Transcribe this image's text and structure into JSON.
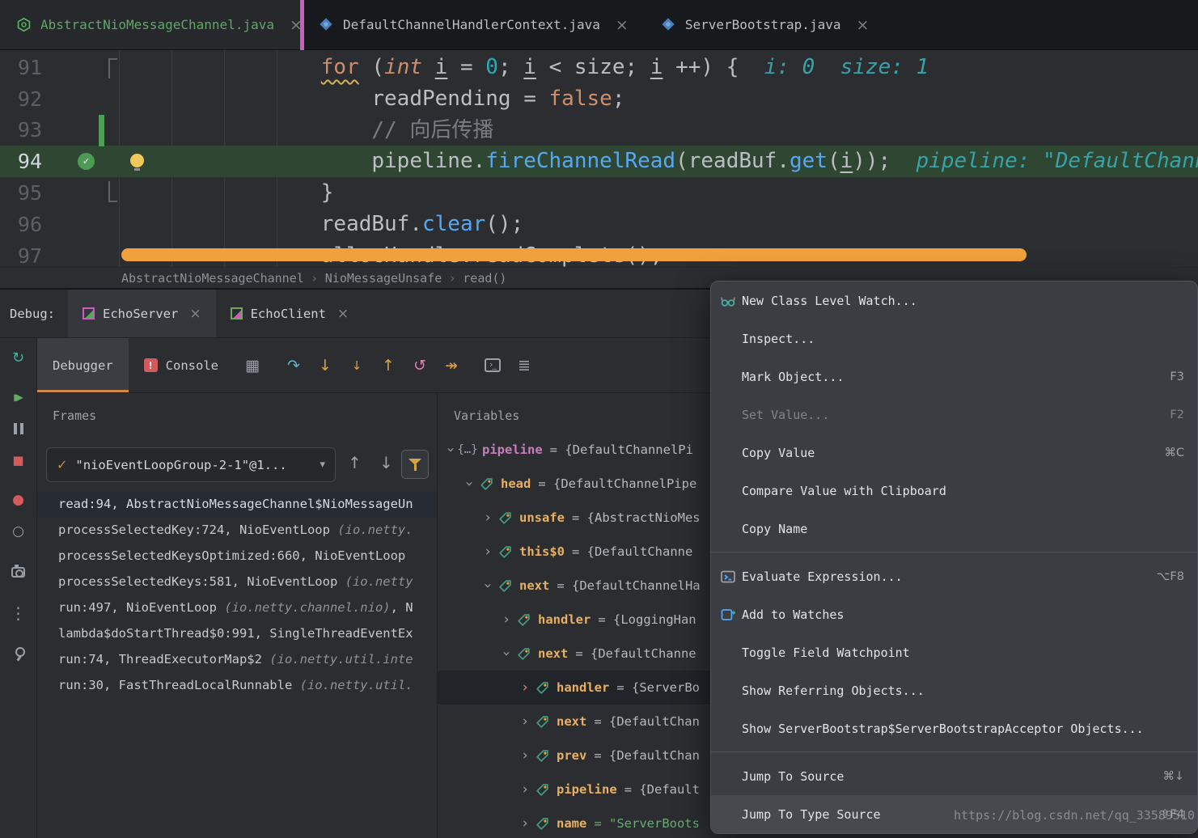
{
  "icons": {
    "check": "✓",
    "combo_arrow": "▾",
    "up_arrow": "↑",
    "down_arrow": "↓",
    "braces": "{…}",
    "close": "×",
    "chevron": "›",
    "breadcrumb_sep": "›"
  },
  "colors": {
    "accent_green": "#5fa865",
    "exec_line": "#2e4632",
    "scrollbar_orange": "#f0a03c",
    "tab_stripe_magenta": "#c75fbc",
    "error_red": "#d35b5b",
    "debugger_tab_underline": "#d08844"
  },
  "editor_tabs": [
    {
      "label": "AbstractNioMessageChannel.java",
      "icon": "class-icon-green",
      "active": true
    },
    {
      "label": "DefaultChannelHandlerContext.java",
      "icon": "class-icon-blue",
      "active": false
    },
    {
      "label": "ServerBootstrap.java",
      "icon": "class-icon-blue",
      "active": false
    }
  ],
  "editor": {
    "lines": [
      {
        "num": "91",
        "indent": 18,
        "tokens": [
          {
            "t": "for",
            "c": "kw wavy"
          },
          {
            "t": " (",
            "c": "pl"
          },
          {
            "t": "int",
            "c": "kw it"
          },
          {
            "t": " ",
            "c": "pl"
          },
          {
            "t": "i",
            "c": "pl u"
          },
          {
            "t": " = ",
            "c": "pl"
          },
          {
            "t": "0",
            "c": "num"
          },
          {
            "t": "; ",
            "c": "pl"
          },
          {
            "t": "i",
            "c": "pl u"
          },
          {
            "t": " < size; ",
            "c": "pl"
          },
          {
            "t": "i",
            "c": "pl u"
          },
          {
            "t": " ++) { ",
            "c": "pl"
          },
          {
            "t": " i: 0  size: 1",
            "c": "hint"
          }
        ]
      },
      {
        "num": "92",
        "indent": 22,
        "tokens": [
          {
            "t": "readPending ",
            "c": "pl"
          },
          {
            "t": "= ",
            "c": "pl"
          },
          {
            "t": "false",
            "c": "kw"
          },
          {
            "t": ";",
            "c": "pl"
          }
        ]
      },
      {
        "num": "93",
        "indent": 22,
        "tokens": [
          {
            "t": "// 向后传播",
            "c": "cmt"
          }
        ]
      },
      {
        "num": "94",
        "indent": 22,
        "exec": true,
        "tokens": [
          {
            "t": "pipeline",
            "c": "pl"
          },
          {
            "t": ".",
            "c": "pl"
          },
          {
            "t": "fireChannelRead",
            "c": "m"
          },
          {
            "t": "(",
            "c": "pl"
          },
          {
            "t": "readBuf",
            "c": "pl"
          },
          {
            "t": ".",
            "c": "pl"
          },
          {
            "t": "get",
            "c": "m"
          },
          {
            "t": "(",
            "c": "pl"
          },
          {
            "t": "i",
            "c": "pl u"
          },
          {
            "t": "));",
            "c": "pl"
          },
          {
            "t": "  pipeline: \"DefaultChannelPipeline\"",
            "c": "hint"
          }
        ]
      },
      {
        "num": "95",
        "indent": 18,
        "tokens": [
          {
            "t": "}",
            "c": "pl"
          }
        ]
      },
      {
        "num": "96",
        "indent": 18,
        "tokens": [
          {
            "t": "readBuf",
            "c": "pl"
          },
          {
            "t": ".",
            "c": "pl"
          },
          {
            "t": "clear",
            "c": "m"
          },
          {
            "t": "();",
            "c": "pl"
          }
        ]
      },
      {
        "num": "97",
        "indent": 18,
        "tokens": [
          {
            "t": "allocHandle.readComplete();",
            "c": "pl"
          }
        ]
      }
    ],
    "breadcrumb": [
      "AbstractNioMessageChannel",
      "NioMessageUnsafe",
      "read()"
    ]
  },
  "debug": {
    "label": "Debug:",
    "session_tabs": [
      {
        "label": "EchoServer",
        "icon": "run-config-server-icon",
        "active": true
      },
      {
        "label": "EchoClient",
        "icon": "run-config-client-icon",
        "active": false
      }
    ],
    "view_tabs": [
      {
        "label": "Debugger",
        "active": true
      },
      {
        "label": "Console",
        "icon": "console-error-icon",
        "badge": "!",
        "active": false
      }
    ],
    "toolbar_icons": [
      {
        "name": "restore-layout-icon",
        "glyph": "▦",
        "cls": "ic-gray"
      },
      {
        "name": "step-over-icon",
        "glyph": "↷",
        "cls": "ic-blue",
        "gap": true
      },
      {
        "name": "step-into-icon",
        "glyph": "↓",
        "cls": "ic-amber"
      },
      {
        "name": "force-step-into-icon",
        "glyph": "↓",
        "cls": "ic-amber sm"
      },
      {
        "name": "step-out-icon",
        "glyph": "↑",
        "cls": "ic-amber"
      },
      {
        "name": "reset-frame-icon",
        "glyph": "↺",
        "cls": "ic-pink"
      },
      {
        "name": "run-to-cursor-icon",
        "glyph": "↠",
        "cls": "ic-amber"
      },
      {
        "name": "open-console-icon",
        "glyph": "›_",
        "cls": "ic-consolebox",
        "gap": true
      },
      {
        "name": "settings-sliders-icon",
        "glyph": "≣",
        "cls": "ic-gray"
      }
    ],
    "rail_icons": [
      {
        "name": "rerun-icon",
        "glyph": "↻",
        "cls": "ic-teal s18"
      },
      {
        "name": "resume-icon",
        "glyph": "▶▶",
        "cls": "resume"
      },
      {
        "name": "pause-icon",
        "glyph": "",
        "cls": "ic-pause"
      },
      {
        "name": "stop-icon",
        "glyph": "■",
        "cls": "ic-red s15"
      },
      {
        "name": "record-icon",
        "glyph": "●",
        "cls": "ic-red s17"
      },
      {
        "name": "breakpoint-circle-icon",
        "glyph": "○",
        "cls": "ic-gray s17"
      },
      {
        "name": "screenshot-icon",
        "glyph": "",
        "cls": "ic-camera"
      },
      {
        "name": "more-icon",
        "glyph": "⋮",
        "cls": "ic-gray s20"
      },
      {
        "name": "pin-icon",
        "glyph": "",
        "cls": "ic-pin"
      }
    ],
    "frames": {
      "title": "Frames",
      "thread": "\"nioEventLoopGroup-2-1\"@1...",
      "rows": [
        {
          "selected": true,
          "parts": [
            {
              "t": "read:94, AbstractNioMessageChannel$NioMessageUn"
            }
          ]
        },
        {
          "parts": [
            {
              "t": "processSelectedKey:724, NioEventLoop "
            },
            {
              "t": "(io.netty.",
              "em": true
            }
          ]
        },
        {
          "parts": [
            {
              "t": "processSelectedKeysOptimized:660, NioEventLoop"
            }
          ]
        },
        {
          "parts": [
            {
              "t": "processSelectedKeys:581, NioEventLoop "
            },
            {
              "t": "(io.netty",
              "em": true
            }
          ]
        },
        {
          "parts": [
            {
              "t": "run:497, NioEventLoop "
            },
            {
              "t": "(io.netty.channel.nio)",
              "em": true
            },
            {
              "t": ", N"
            }
          ]
        },
        {
          "parts": [
            {
              "t": "lambda$doStartThread$0:991, SingleThreadEventEx"
            }
          ]
        },
        {
          "parts": [
            {
              "t": "run:74, ThreadExecutorMap$2 "
            },
            {
              "t": "(io.netty.util.inte",
              "em": true
            }
          ]
        },
        {
          "parts": [
            {
              "t": "run:30, FastThreadLocalRunnable "
            },
            {
              "t": "(io.netty.util.",
              "em": true
            }
          ]
        }
      ]
    },
    "variables": {
      "title": "Variables",
      "rows": [
        {
          "indent": 0,
          "exp": true,
          "icon": "braces",
          "name": "pipeline",
          "kind": "local",
          "value": "= {DefaultChannelPi"
        },
        {
          "indent": 1,
          "exp": true,
          "icon": "tag",
          "name": "head",
          "kind": "field",
          "value": "= {DefaultChannelPipe"
        },
        {
          "indent": 2,
          "exp": false,
          "icon": "tag",
          "name": "unsafe",
          "kind": "field",
          "value": "= {AbstractNioMes"
        },
        {
          "indent": 2,
          "exp": false,
          "icon": "tag",
          "name": "this$0",
          "kind": "field",
          "value": "= {DefaultChanne"
        },
        {
          "indent": 2,
          "exp": true,
          "icon": "tag",
          "name": "next",
          "kind": "field",
          "value": "= {DefaultChannelHa"
        },
        {
          "indent": 3,
          "exp": false,
          "icon": "tag",
          "name": "handler",
          "kind": "field",
          "value": "= {LoggingHan"
        },
        {
          "indent": 3,
          "exp": true,
          "icon": "tag",
          "name": "next",
          "kind": "field",
          "value": "= {DefaultChanne"
        },
        {
          "indent": 4,
          "exp": false,
          "icon": "tag",
          "name": "handler",
          "kind": "field",
          "value": "= {ServerBo",
          "selected": true
        },
        {
          "indent": 4,
          "exp": false,
          "icon": "tag",
          "name": "next",
          "kind": "field",
          "value": "= {DefaultChan"
        },
        {
          "indent": 4,
          "exp": false,
          "icon": "tag",
          "name": "prev",
          "kind": "field",
          "value": "= {DefaultChan"
        },
        {
          "indent": 4,
          "exp": false,
          "icon": "tag",
          "name": "pipeline",
          "kind": "field",
          "value": "= {Default"
        },
        {
          "indent": 4,
          "exp": false,
          "icon": "tag",
          "name": "name",
          "kind": "field",
          "value": "= \"ServerBoots",
          "string": true
        }
      ]
    }
  },
  "context_menu": {
    "items": [
      {
        "label": "New Class Level Watch...",
        "icon": "watch-icon"
      },
      {
        "label": "Inspect..."
      },
      {
        "label": "Mark Object...",
        "shortcut": "F3"
      },
      {
        "label": "Set Value...",
        "shortcut": "F2",
        "disabled": true
      },
      {
        "label": "Copy Value",
        "shortcut": "⌘C"
      },
      {
        "label": "Compare Value with Clipboard"
      },
      {
        "label": "Copy Name"
      },
      {
        "type": "separator"
      },
      {
        "label": "Evaluate Expression...",
        "icon": "evaluate-icon",
        "shortcut": "⌥F8"
      },
      {
        "label": "Add to Watches",
        "icon": "add-watch-icon"
      },
      {
        "label": "Toggle Field Watchpoint"
      },
      {
        "label": "Show Referring Objects..."
      },
      {
        "label": "Show ServerBootstrap$ServerBootstrapAcceptor Objects..."
      },
      {
        "type": "separator"
      },
      {
        "label": "Jump To Source",
        "shortcut": "⌘↓"
      },
      {
        "label": "Jump To Type Source",
        "shortcut": "⇧F4",
        "hover": true
      }
    ]
  },
  "watermark": "https://blog.csdn.net/qq_33589510"
}
